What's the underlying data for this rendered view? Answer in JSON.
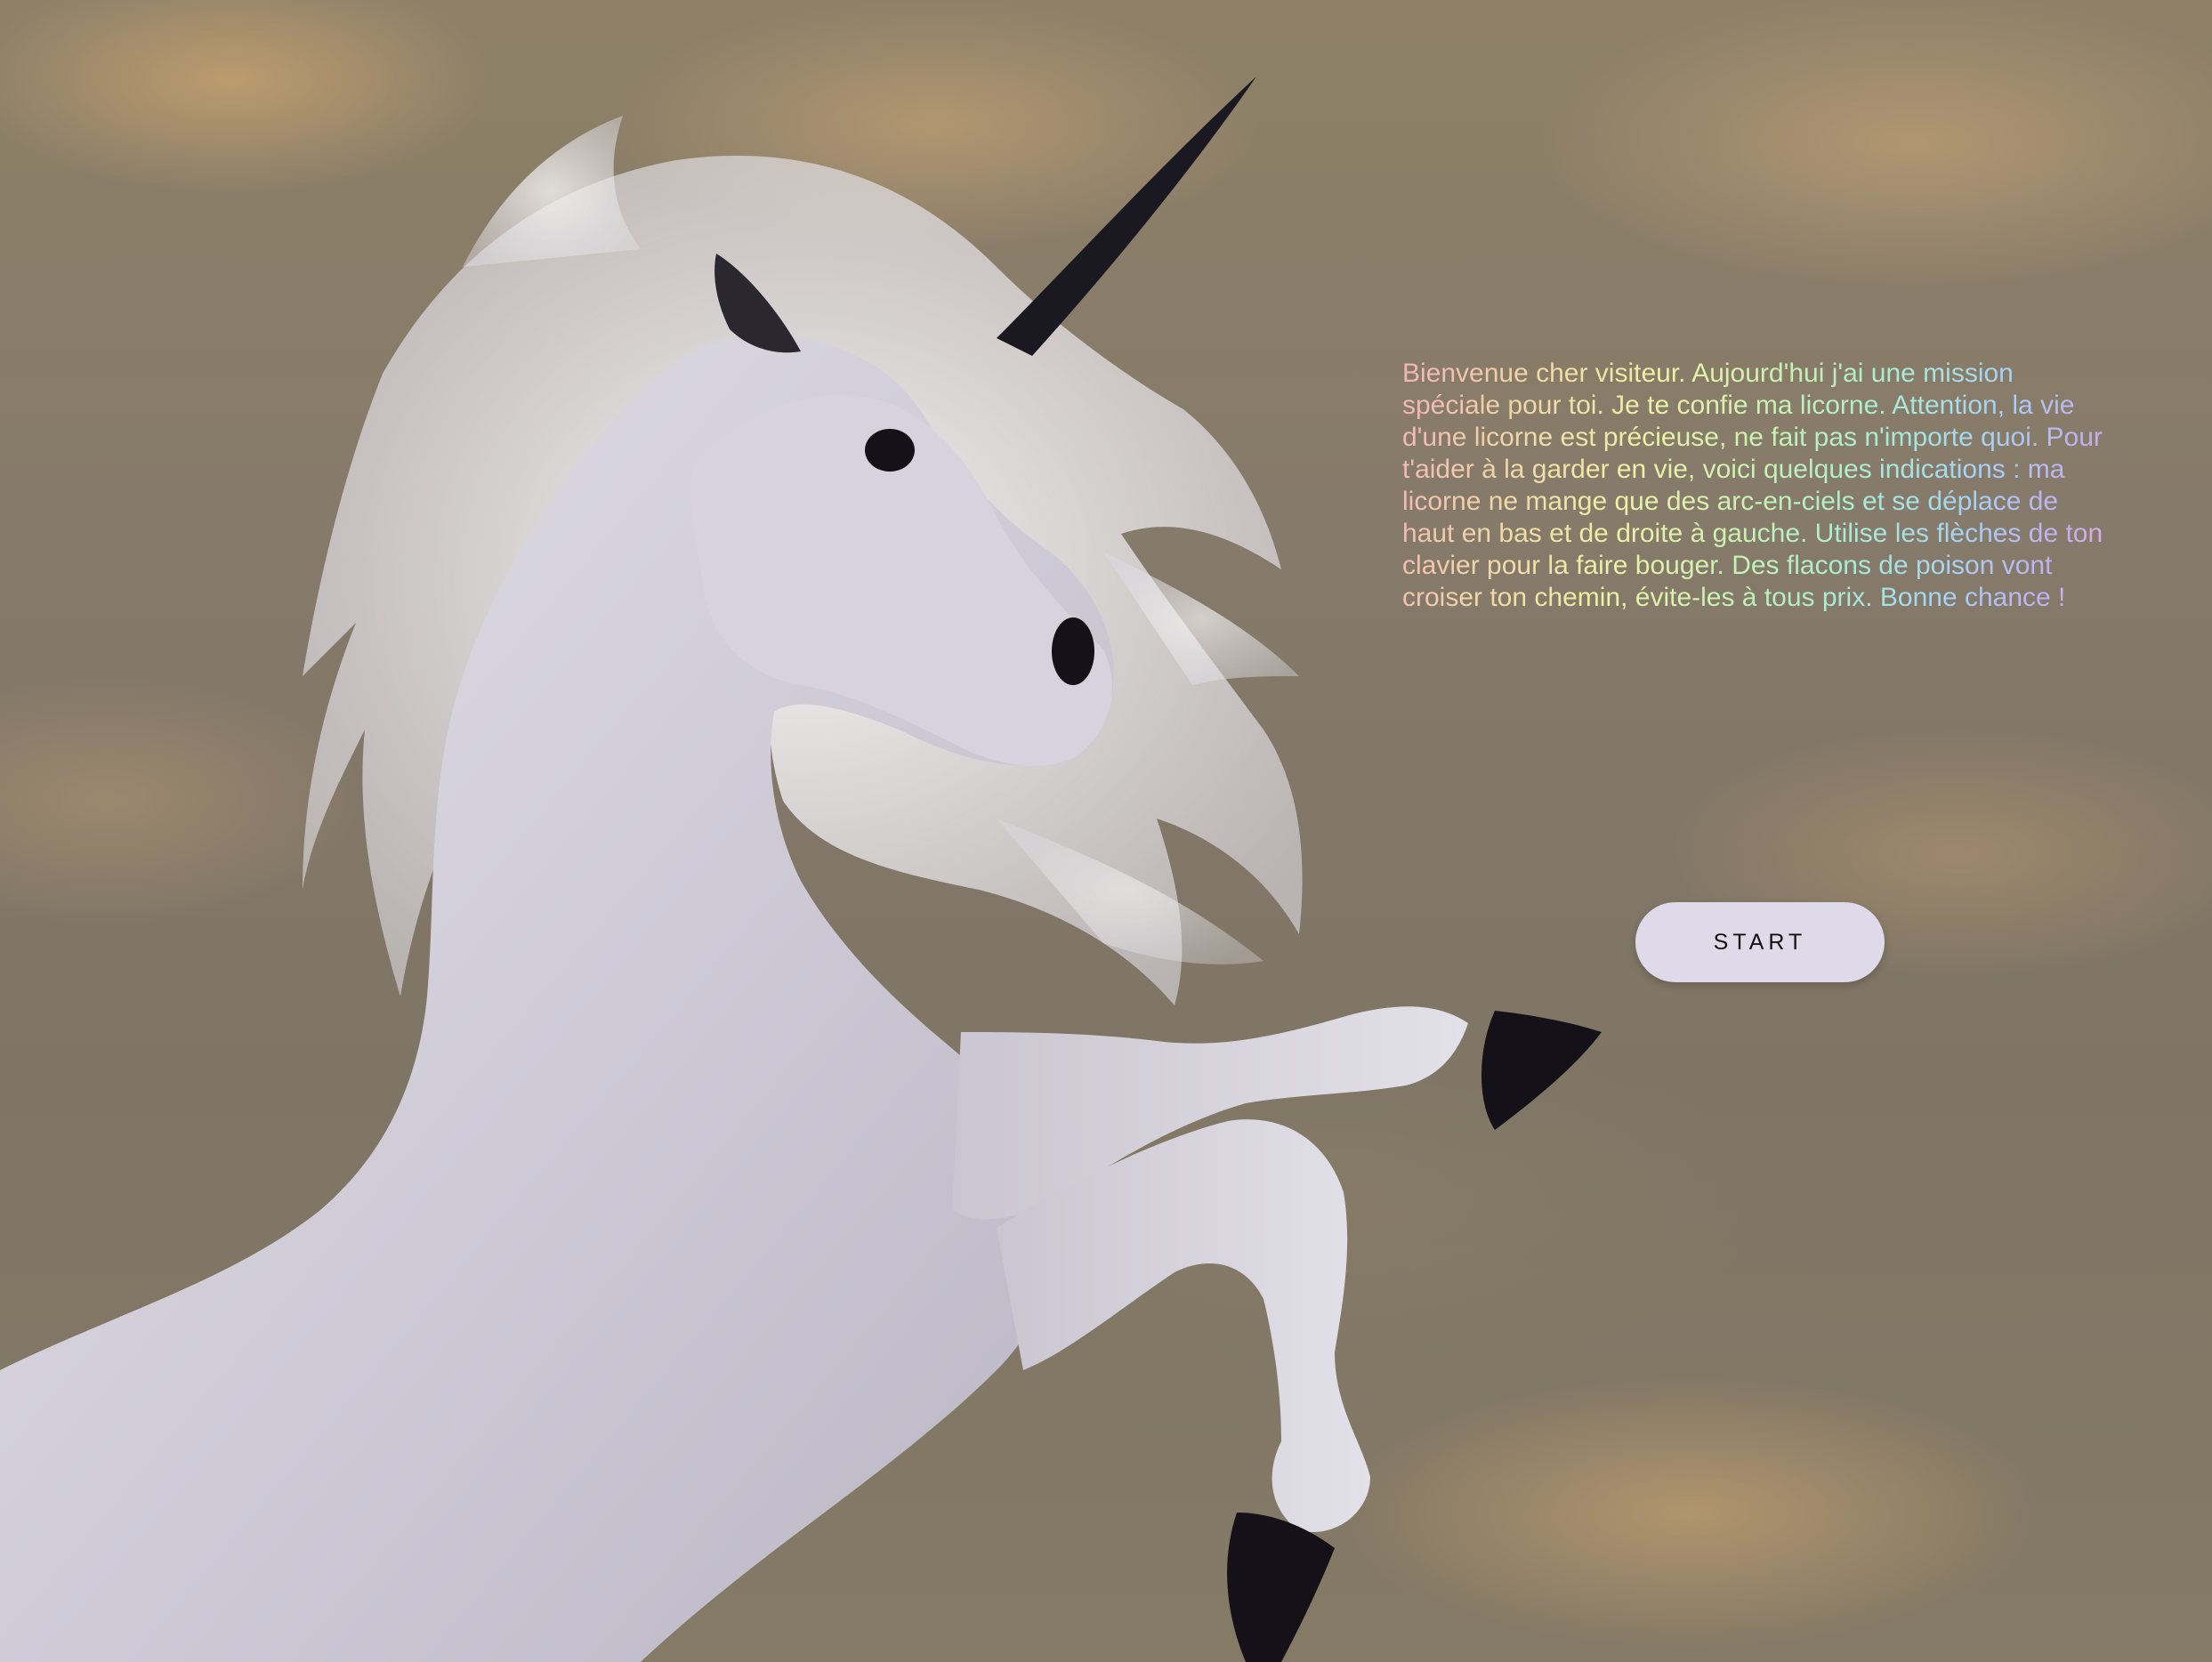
{
  "intro": {
    "text": "Bienvenue cher visiteur. Aujourd'hui j'ai une mission spéciale pour toi. Je te confie ma licorne. Attention, la vie d'une licorne est précieuse, ne fait pas n'importe quoi. Pour t'aider à la garder en vie, voici quelques indications : ma licorne ne mange que des arc-en-ciels et se déplace de haut en bas et de droite à gauche. Utilise les flèches de ton clavier pour la faire bouger. Des flacons de poison vont croiser ton chemin, évite-les à tous prix. Bonne chance !"
  },
  "start_button": {
    "label": "START"
  },
  "colors": {
    "sky": "#85796a",
    "cloud": "#c4a070",
    "unicorn_body": "#d9d6e0",
    "hoof_horn": "#141218",
    "button_bg": "#dedaea"
  },
  "icons": {
    "background_art": "unicorn-illustration"
  }
}
